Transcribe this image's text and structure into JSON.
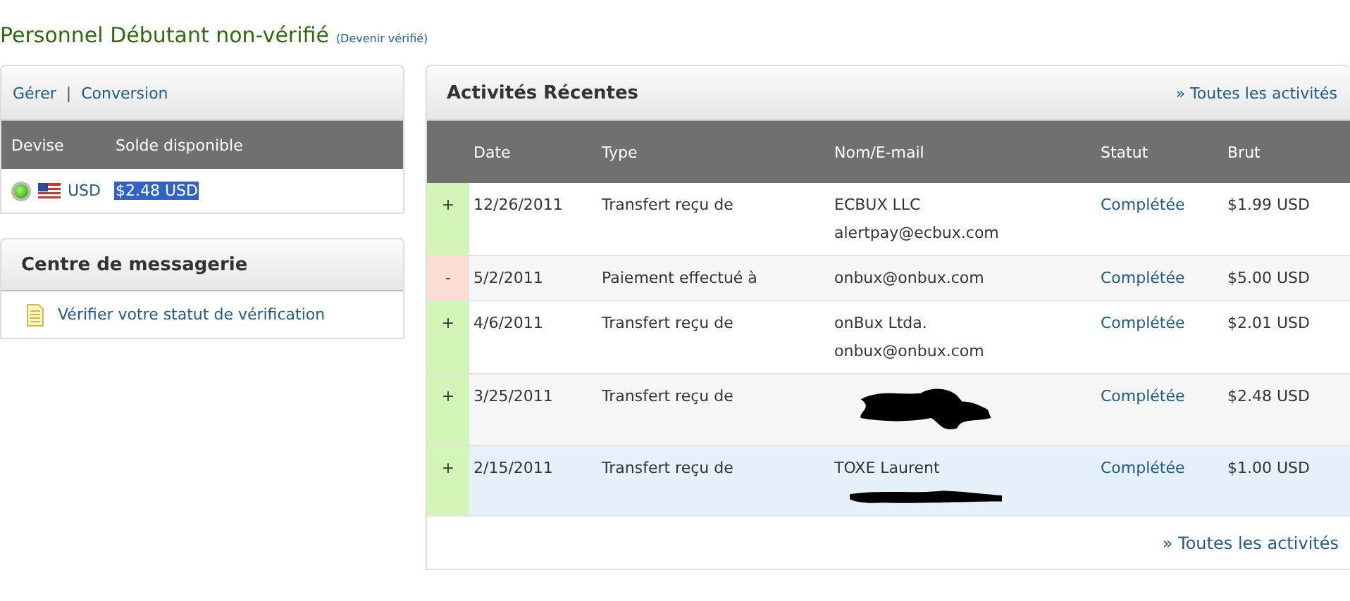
{
  "header": {
    "title": "Personnel Débutant non-vérifié",
    "verify_link": "(Devenir vérifié)"
  },
  "account_panel": {
    "links": [
      "Gérer",
      "Conversion"
    ],
    "separator": "|",
    "columns": [
      "Devise",
      "Solde disponible"
    ],
    "rows": [
      {
        "selected": true,
        "currency": "USD",
        "balance": "$2.48 USD",
        "balance_selected": true
      }
    ]
  },
  "message_center": {
    "title": "Centre de messagerie",
    "items": [
      "Vérifier votre statut de vérification"
    ]
  },
  "activities": {
    "title": "Activités Récentes",
    "top_link": "» Toutes les activités",
    "columns": [
      "Date",
      "Type",
      "Nom/E-mail",
      "Statut",
      "Brut"
    ],
    "rows": [
      {
        "kind": "credit",
        "sign": "+",
        "date": "12/26/2011",
        "type": "Transfert reçu de",
        "name_lines": [
          {
            "kind": "text",
            "text": "ECBUX LLC"
          },
          {
            "kind": "text",
            "text": "alertpay@ecbux.com"
          }
        ],
        "status": "Complétée",
        "amount": "$1.99 USD",
        "highlighted": false
      },
      {
        "kind": "debit",
        "sign": "-",
        "date": "5/2/2011",
        "type": "Paiement effectué à",
        "name_lines": [
          {
            "kind": "text",
            "text": "onbux@onbux.com"
          }
        ],
        "status": "Complétée",
        "amount": "$5.00 USD",
        "highlighted": false
      },
      {
        "kind": "credit",
        "sign": "+",
        "date": "4/6/2011",
        "type": "Transfert reçu de",
        "name_lines": [
          {
            "kind": "text",
            "text": "onBux Ltda."
          },
          {
            "kind": "text",
            "text": "onbux@onbux.com"
          }
        ],
        "status": "Complétée",
        "amount": "$2.01 USD",
        "highlighted": false
      },
      {
        "kind": "credit",
        "sign": "+",
        "date": "3/25/2011",
        "type": "Transfert reçu de",
        "name_lines": [
          {
            "kind": "redacted"
          }
        ],
        "status": "Complétée",
        "amount": "$2.48 USD",
        "highlighted": false
      },
      {
        "kind": "credit",
        "sign": "+",
        "date": "2/15/2011",
        "type": "Transfert reçu de",
        "name_lines": [
          {
            "kind": "text",
            "text": "TOXE Laurent"
          },
          {
            "kind": "redacted-line"
          }
        ],
        "status": "Complétée",
        "amount": "$1.00 USD",
        "highlighted": true
      }
    ],
    "bottom_link": "» Toutes les activités"
  }
}
